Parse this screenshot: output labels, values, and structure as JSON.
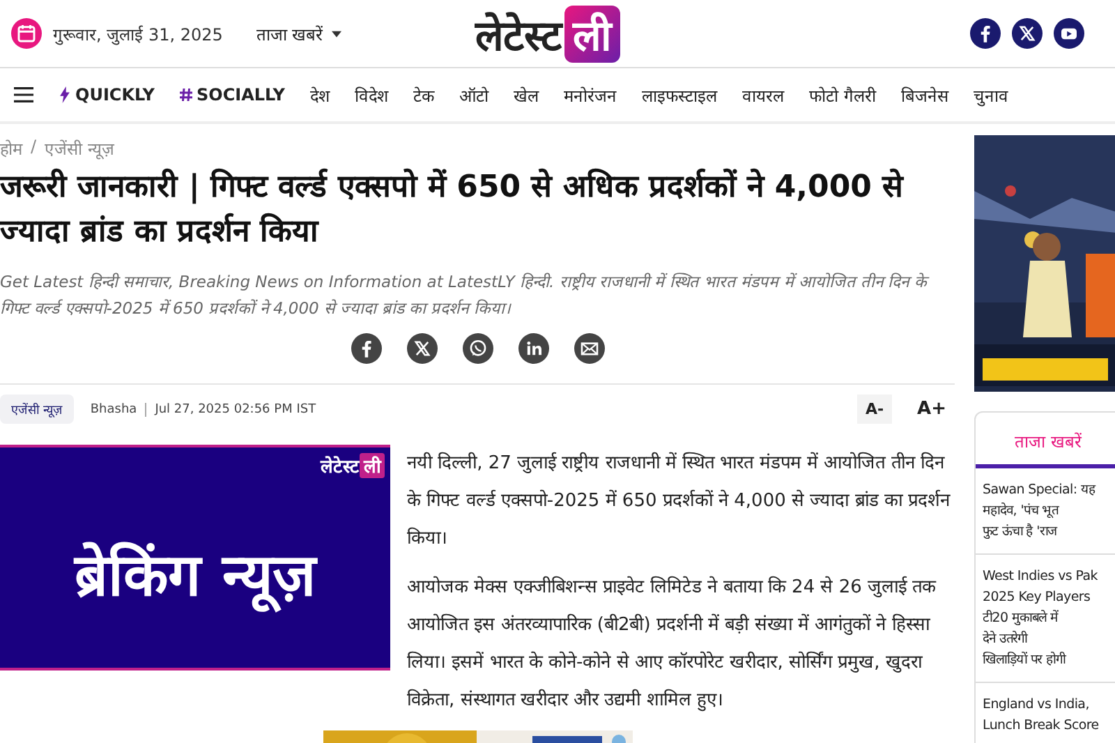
{
  "header": {
    "date": "गुरूवार, जुलाई 31, 2025",
    "dropdown": "ताजा खबरें",
    "logo": {
      "word": "लेटेस्ट",
      "badge": "ली"
    }
  },
  "nav": {
    "items": [
      {
        "label": "QUICKLY",
        "kind": "bolt"
      },
      {
        "label": "SOCIALLY",
        "kind": "hash"
      },
      {
        "label": "देश",
        "kind": "plain"
      },
      {
        "label": "विदेश",
        "kind": "plain"
      },
      {
        "label": "टेक",
        "kind": "plain"
      },
      {
        "label": "ऑटो",
        "kind": "plain"
      },
      {
        "label": "खेल",
        "kind": "plain"
      },
      {
        "label": "मनोरंजन",
        "kind": "plain"
      },
      {
        "label": "लाइफस्टाइल",
        "kind": "plain"
      },
      {
        "label": "वायरल",
        "kind": "plain"
      },
      {
        "label": "फोटो गैलरी",
        "kind": "plain"
      },
      {
        "label": "बिजनेस",
        "kind": "plain"
      },
      {
        "label": "चुनाव",
        "kind": "plain"
      }
    ]
  },
  "breadcrumb": {
    "items": [
      "होम",
      "एजेंसी न्यूज़"
    ],
    "separator": "/"
  },
  "article": {
    "title": "जरूरी जानकारी | गिफ्ट वर्ल्ड एक्सपो में 650 से अधिक प्रदर्शकों ने 4,000 से ज्यादा ब्रांड का प्रदर्शन किया",
    "summary": "Get Latest हिन्दी समाचार, Breaking News on Information at LatestLY हिन्दी. राष्ट्रीय राजधानी में स्थित भारत मंडपम में आयोजित तीन दिन के गिफ्ट वर्ल्ड एक्सपो-2025 में 650 प्रदर्शकों ने 4,000 से ज्यादा ब्रांड का प्रदर्शन किया।",
    "category": "एजेंसी न्यूज़",
    "author": "Bhasha",
    "published": "Jul 27, 2025 02:56 PM IST",
    "font_buttons": [
      "A-",
      "A+"
    ],
    "banner": {
      "logo_word": "लेटेस्ट",
      "logo_badge": "ली",
      "headline": "ब्रेकिंग न्यूज़"
    },
    "paragraphs": [
      "नयी दिल्ली, 27 जुलाई राष्ट्रीय राजधानी में स्थित भारत मंडपम में आयोजित तीन दिन के गिफ्ट वर्ल्ड एक्सपो-2025 में 650 प्रदर्शकों ने 4,000 से ज्यादा ब्रांड का प्रदर्शन किया।",
      "आयोजक मेक्स एक्जीबिशन्स प्राइवेट लिमिटेड ने बताया कि 24 से 26 जुलाई तक आयोजित इस अंतरव्यापारिक (बी2बी) प्रदर्शनी में बड़ी संख्या में आगंतुकों ने हिस्सा लिया। इसमें भारत के कोने-कोने से आए कॉरपोरेट खरीदार, सोर्सिंग प्रमुख, खुदरा विक्रेता, संस्थागत खरीदार और उद्यमी शामिल हुए।"
    ]
  },
  "sidebar": {
    "tabs": [
      {
        "label": "ताजा खबरें",
        "selected": true
      }
    ],
    "items": [
      {
        "lines": [
          "Sawan Special: यह",
          "महादेव, 'पंच भूत",
          "फुट ऊंचा है 'राज"
        ]
      },
      {
        "lines": [
          "West Indies vs Pak",
          "2025 Key Players",
          "टी20 मुकाबले में",
          "देने उतरेगी",
          "खिलाड़ियों पर होगी"
        ]
      },
      {
        "lines": [
          "England vs India,",
          "Lunch Break Score"
        ]
      }
    ]
  }
}
